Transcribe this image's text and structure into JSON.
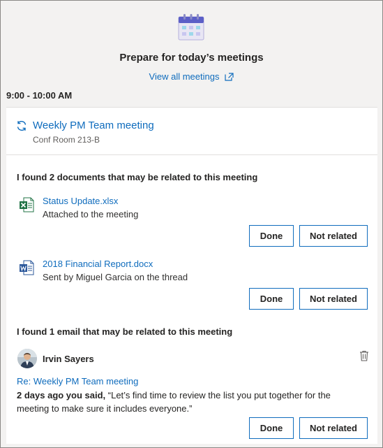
{
  "header": {
    "title": "Prepare for today’s meetings",
    "view_all_label": "View all meetings"
  },
  "time_slot": "9:00 - 10:00 AM",
  "meeting": {
    "title": "Weekly PM Team meeting",
    "location": "Conf Room 213-B"
  },
  "documents_section": {
    "title": "I found 2 documents that may be related to this meeting",
    "items": [
      {
        "icon": "excel-file-icon",
        "name": "Status Update.xlsx",
        "subtitle": "Attached to the meeting",
        "done_label": "Done",
        "not_related_label": "Not related"
      },
      {
        "icon": "word-file-icon",
        "name": "2018 Financial Report.docx",
        "subtitle": "Sent by Miguel Garcia on the thread",
        "done_label": "Done",
        "not_related_label": "Not related"
      }
    ]
  },
  "email_section": {
    "title": "I found 1 email that may be related to this meeting",
    "sender": "Irvin Sayers",
    "subject": "Re: Weekly PM Team meeting",
    "body_prefix": "2 days ago you said,",
    "body_quote": " “Let’s find time to review the list you put together for the meeting to make sure it includes everyone.”",
    "done_label": "Done",
    "not_related_label": "Not related"
  },
  "colors": {
    "accent": "#0f6cbd",
    "excel": "#217346",
    "word": "#2b579a",
    "background": "#f3f2f1"
  }
}
